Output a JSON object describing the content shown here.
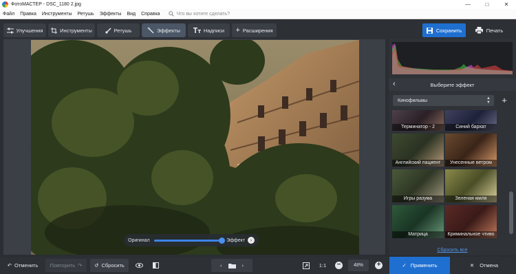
{
  "window": {
    "title": "ФотоМАСТЕР - DSC_1180 2.jpg",
    "controls": {
      "minimize": "—",
      "maximize": "□",
      "close": "✕"
    }
  },
  "menu": {
    "items": [
      "Файл",
      "Правка",
      "Инструменты",
      "Ретушь",
      "Эффекты",
      "Вид",
      "Справка"
    ],
    "search_placeholder": "Что вы хотите сделать?"
  },
  "toolbar": {
    "tabs": [
      {
        "label": "Улучшения",
        "icon": "sliders-icon"
      },
      {
        "label": "Инструменты",
        "icon": "crop-icon"
      },
      {
        "label": "Ретушь",
        "icon": "brush-icon"
      },
      {
        "label": "Эффекты",
        "icon": "magic-wand-icon",
        "active": true
      },
      {
        "label": "Надписи",
        "icon": "text-icon"
      },
      {
        "label": "Расширения",
        "icon": "plus-icon"
      }
    ],
    "save_label": "Сохранить",
    "print_label": "Печать"
  },
  "compare": {
    "left_label": "Оригинал",
    "right_label": "Эффект",
    "position": 0.95
  },
  "panel": {
    "title": "Выберите эффект",
    "category": "Кинофильмы",
    "effects": [
      {
        "label": "Терминатор - 2",
        "tint": "#3c2f3a"
      },
      {
        "label": "Синий бархат",
        "tint": "#2a2f4a"
      },
      {
        "label": "Английский пациент",
        "tint": "#4a4a33"
      },
      {
        "label": "Унесенные ветром",
        "tint": "#5a3a26"
      },
      {
        "label": "Игры разума",
        "tint": "#3f4a2f"
      },
      {
        "label": "Зеленая миля",
        "tint": "#6a6a3a"
      },
      {
        "label": "Матрица",
        "tint": "#244a30"
      },
      {
        "label": "Криминальное чтиво",
        "tint": "#4a2a26"
      }
    ],
    "reset_all": "Сбросить все"
  },
  "bottom": {
    "undo": "Отменить",
    "redo": "Повторить",
    "reset": "Сбросить",
    "ratio": "1:1",
    "zoom": "48%",
    "apply": "Применить",
    "cancel": "Отмена"
  },
  "colors": {
    "accent": "#1f6fd1",
    "link": "#4f95ec",
    "panel_bg": "#2f3237"
  }
}
